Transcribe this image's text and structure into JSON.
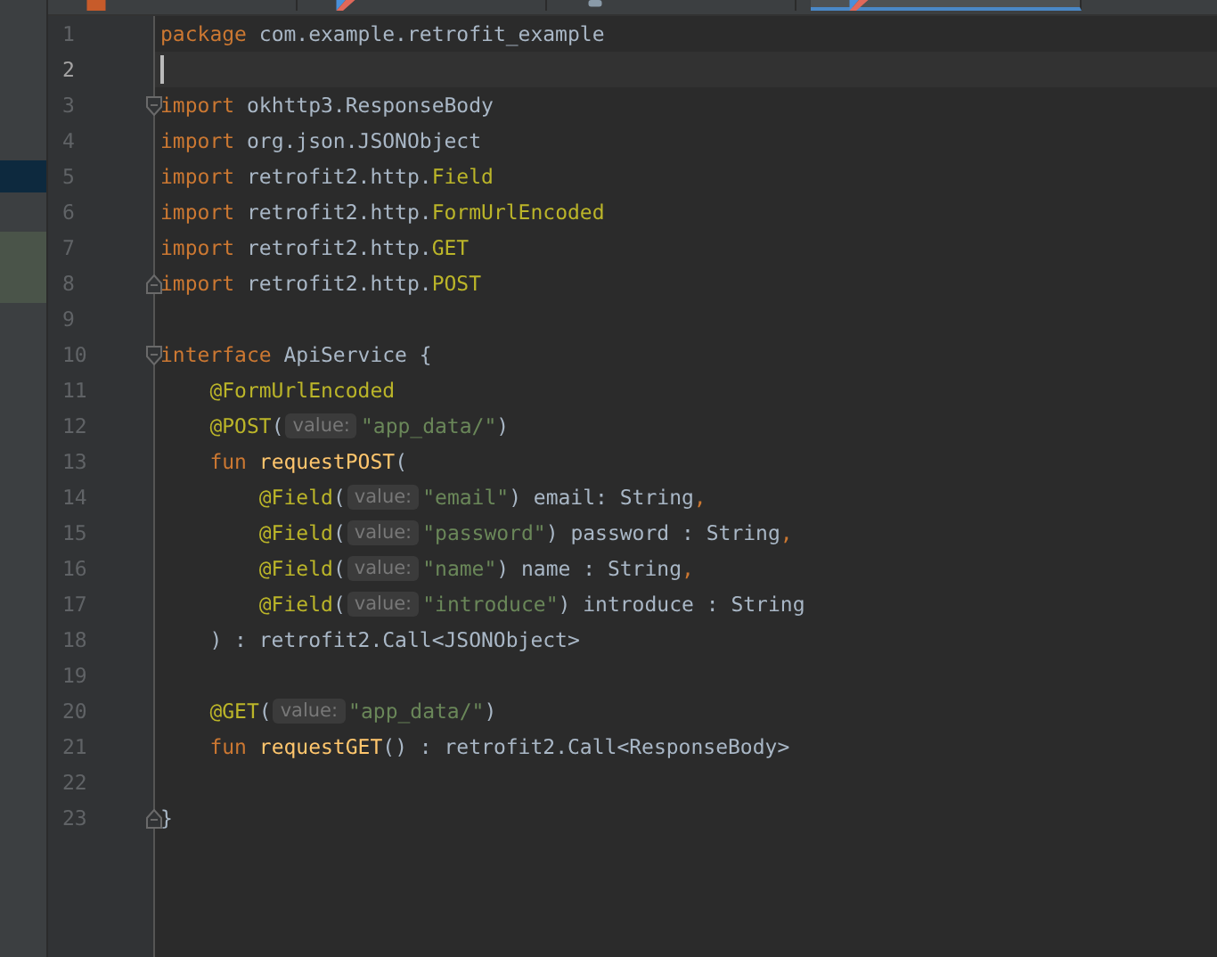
{
  "tabs": [
    {
      "kind": "xml",
      "selected": false
    },
    {
      "kind": "kotlin",
      "selected": false
    },
    {
      "kind": "gradle",
      "selected": false
    },
    {
      "kind": "kotlin",
      "selected": true
    }
  ],
  "sidebar": {
    "rows": [
      {
        "kind": "selection"
      },
      {
        "kind": "modified"
      }
    ]
  },
  "editor": {
    "lines": [
      {
        "number": "1",
        "current": false,
        "segments": [
          {
            "kind": "code",
            "tokens": [
              {
                "kind": "keyword",
                "text": "package"
              },
              {
                "kind": "plain",
                "text": " com.example.retrofit_example"
              }
            ]
          }
        ]
      },
      {
        "number": "2",
        "current": true
      },
      {
        "number": "3",
        "current": false,
        "fold_start": true,
        "segments": [
          {
            "kind": "code",
            "tokens": [
              {
                "kind": "keyword",
                "text": "import"
              },
              {
                "kind": "plain",
                "text": " okhttp3.ResponseBody"
              }
            ]
          }
        ]
      },
      {
        "number": "4",
        "current": false,
        "segments": [
          {
            "kind": "code",
            "tokens": [
              {
                "kind": "keyword",
                "text": "import"
              },
              {
                "kind": "plain",
                "text": " org.json.JSONObject"
              }
            ]
          }
        ]
      },
      {
        "number": "5",
        "current": false,
        "segments": [
          {
            "kind": "code",
            "tokens": [
              {
                "kind": "keyword",
                "text": "import"
              },
              {
                "kind": "plain",
                "text": " retrofit2.http."
              },
              {
                "kind": "annotation",
                "text": "Field"
              }
            ]
          }
        ]
      },
      {
        "number": "6",
        "current": false,
        "segments": [
          {
            "kind": "code",
            "tokens": [
              {
                "kind": "keyword",
                "text": "import"
              },
              {
                "kind": "plain",
                "text": " retrofit2.http."
              },
              {
                "kind": "annotation",
                "text": "FormUrlEncoded"
              }
            ]
          }
        ]
      },
      {
        "number": "7",
        "current": false,
        "segments": [
          {
            "kind": "code",
            "tokens": [
              {
                "kind": "keyword",
                "text": "import"
              },
              {
                "kind": "plain",
                "text": " retrofit2.http."
              },
              {
                "kind": "annotation",
                "text": "GET"
              }
            ]
          }
        ]
      },
      {
        "number": "8",
        "current": false,
        "fold_end": true,
        "segments": [
          {
            "kind": "code",
            "tokens": [
              {
                "kind": "keyword",
                "text": "import"
              },
              {
                "kind": "plain",
                "text": " retrofit2.http."
              },
              {
                "kind": "annotation",
                "text": "POST"
              }
            ]
          }
        ]
      },
      {
        "number": "9",
        "current": false
      },
      {
        "number": "10",
        "current": false,
        "fold_start": true,
        "segments": [
          {
            "kind": "code",
            "tokens": [
              {
                "kind": "keyword",
                "text": "interface"
              },
              {
                "kind": "plain",
                "text": " ApiService {"
              }
            ]
          }
        ]
      },
      {
        "number": "11",
        "current": false,
        "segments": [
          {
            "kind": "code",
            "tokens": [
              {
                "kind": "annotation",
                "text": "    @FormUrlEncoded"
              }
            ]
          }
        ]
      },
      {
        "number": "12",
        "current": false,
        "segments": [
          {
            "kind": "code",
            "tokens": [
              {
                "kind": "annotation",
                "text": "    @POST"
              },
              {
                "kind": "plain",
                "text": "("
              }
            ]
          },
          {
            "kind": "hint",
            "text": "value:"
          },
          {
            "kind": "code",
            "tokens": [
              {
                "kind": "string",
                "text": "\"app_data/\""
              },
              {
                "kind": "plain",
                "text": ")"
              }
            ]
          }
        ]
      },
      {
        "number": "13",
        "current": false,
        "segments": [
          {
            "kind": "code",
            "tokens": [
              {
                "kind": "keyword",
                "text": "    fun"
              },
              {
                "kind": "function",
                "text": " requestPOST"
              },
              {
                "kind": "plain",
                "text": "("
              }
            ]
          }
        ]
      },
      {
        "number": "14",
        "current": false,
        "segments": [
          {
            "kind": "code",
            "tokens": [
              {
                "kind": "annotation",
                "text": "        @Field"
              },
              {
                "kind": "plain",
                "text": "("
              }
            ]
          },
          {
            "kind": "hint",
            "text": "value:"
          },
          {
            "kind": "code",
            "tokens": [
              {
                "kind": "string",
                "text": "\"email\""
              },
              {
                "kind": "plain",
                "text": ") email: String"
              },
              {
                "kind": "keyword",
                "text": ","
              }
            ]
          }
        ]
      },
      {
        "number": "15",
        "current": false,
        "segments": [
          {
            "kind": "code",
            "tokens": [
              {
                "kind": "annotation",
                "text": "        @Field"
              },
              {
                "kind": "plain",
                "text": "("
              }
            ]
          },
          {
            "kind": "hint",
            "text": "value:"
          },
          {
            "kind": "code",
            "tokens": [
              {
                "kind": "string",
                "text": "\"password\""
              },
              {
                "kind": "plain",
                "text": ") password : String"
              },
              {
                "kind": "keyword",
                "text": ","
              }
            ]
          }
        ]
      },
      {
        "number": "16",
        "current": false,
        "segments": [
          {
            "kind": "code",
            "tokens": [
              {
                "kind": "annotation",
                "text": "        @Field"
              },
              {
                "kind": "plain",
                "text": "("
              }
            ]
          },
          {
            "kind": "hint",
            "text": "value:"
          },
          {
            "kind": "code",
            "tokens": [
              {
                "kind": "string",
                "text": "\"name\""
              },
              {
                "kind": "plain",
                "text": ") name : String"
              },
              {
                "kind": "keyword",
                "text": ","
              }
            ]
          }
        ]
      },
      {
        "number": "17",
        "current": false,
        "segments": [
          {
            "kind": "code",
            "tokens": [
              {
                "kind": "annotation",
                "text": "        @Field"
              },
              {
                "kind": "plain",
                "text": "("
              }
            ]
          },
          {
            "kind": "hint",
            "text": "value:"
          },
          {
            "kind": "code",
            "tokens": [
              {
                "kind": "string",
                "text": "\"introduce\""
              },
              {
                "kind": "plain",
                "text": ") introduce : String"
              }
            ]
          }
        ]
      },
      {
        "number": "18",
        "current": false,
        "segments": [
          {
            "kind": "code",
            "tokens": [
              {
                "kind": "plain",
                "text": "    ) : retrofit2.Call<JSONObject>"
              }
            ]
          }
        ]
      },
      {
        "number": "19",
        "current": false
      },
      {
        "number": "20",
        "current": false,
        "segments": [
          {
            "kind": "code",
            "tokens": [
              {
                "kind": "annotation",
                "text": "    @GET"
              },
              {
                "kind": "plain",
                "text": "("
              }
            ]
          },
          {
            "kind": "hint",
            "text": "value:"
          },
          {
            "kind": "code",
            "tokens": [
              {
                "kind": "string",
                "text": "\"app_data/\""
              },
              {
                "kind": "plain",
                "text": ")"
              }
            ]
          }
        ]
      },
      {
        "number": "21",
        "current": false,
        "segments": [
          {
            "kind": "code",
            "tokens": [
              {
                "kind": "keyword",
                "text": "    fun"
              },
              {
                "kind": "function",
                "text": " requestGET"
              },
              {
                "kind": "plain",
                "text": "() : retrofit2.Call<ResponseBody>"
              }
            ]
          }
        ]
      },
      {
        "number": "22",
        "current": false
      },
      {
        "number": "23",
        "current": false,
        "fold_end": true,
        "segments": [
          {
            "kind": "code",
            "tokens": [
              {
                "kind": "plain",
                "text": "}"
              }
            ]
          }
        ]
      }
    ]
  }
}
